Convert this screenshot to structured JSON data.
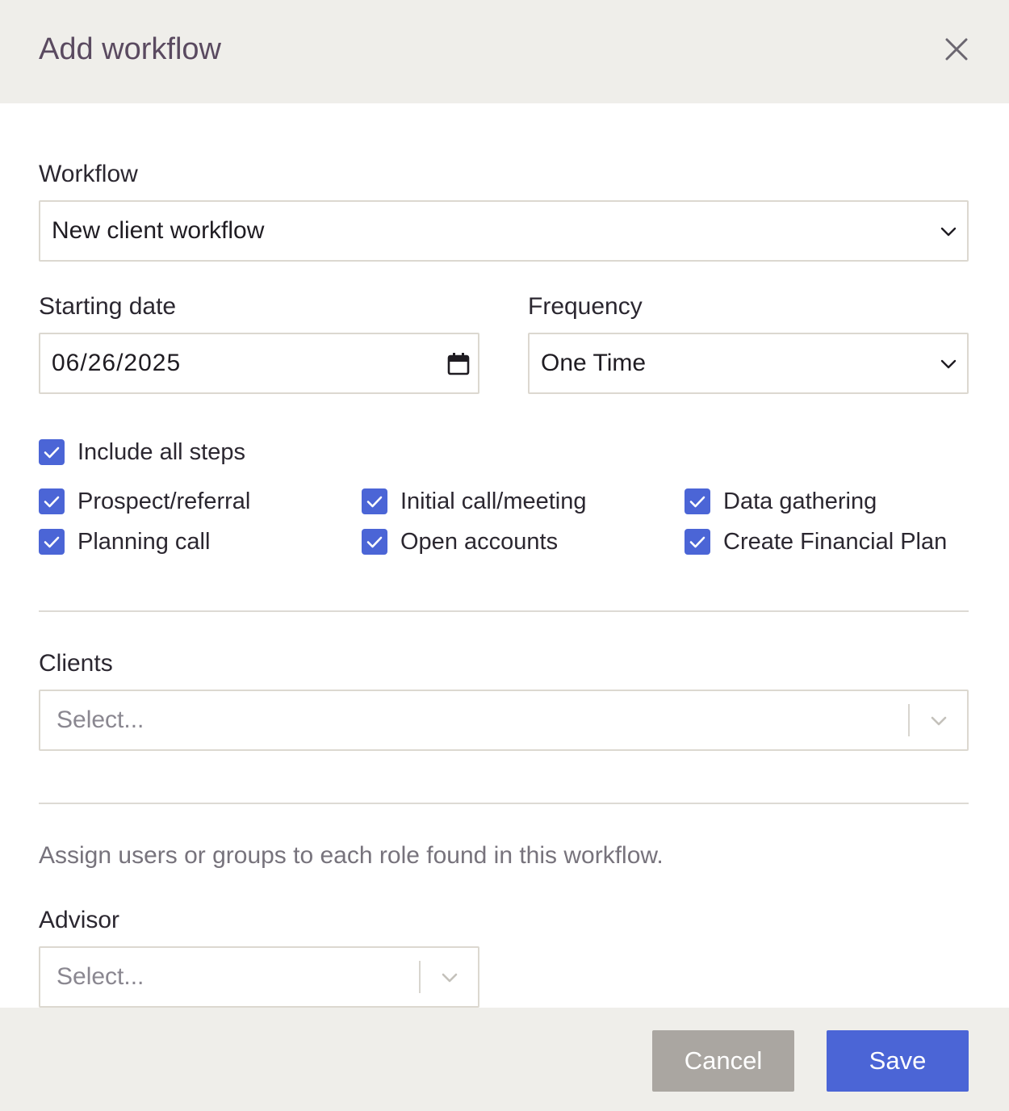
{
  "dialog": {
    "title": "Add workflow"
  },
  "workflow": {
    "label": "Workflow",
    "value": "New client workflow"
  },
  "starting_date": {
    "label": "Starting date",
    "value": "06/26/2025"
  },
  "frequency": {
    "label": "Frequency",
    "value": "One Time"
  },
  "steps": {
    "include_all": {
      "label": "Include all steps",
      "checked": true
    },
    "items": [
      {
        "label": "Prospect/referral",
        "checked": true
      },
      {
        "label": "Initial call/meeting",
        "checked": true
      },
      {
        "label": "Data gathering",
        "checked": true
      },
      {
        "label": "Planning call",
        "checked": true
      },
      {
        "label": "Open accounts",
        "checked": true
      },
      {
        "label": "Create Financial Plan",
        "checked": true
      }
    ]
  },
  "clients": {
    "label": "Clients",
    "placeholder": "Select..."
  },
  "roles": {
    "hint": "Assign users or groups to each role found in this workflow.",
    "advisor": {
      "label": "Advisor",
      "placeholder": "Select..."
    }
  },
  "footer": {
    "cancel_label": "Cancel",
    "save_label": "Save"
  },
  "colors": {
    "accent": "#4b65d6",
    "header_bg": "#efeeea",
    "cancel_bg": "#aaa6a1",
    "title": "#5a4a60"
  },
  "icons": {
    "close": "close-icon",
    "chevron": "chevron-down-icon",
    "calendar": "calendar-icon",
    "check": "check-icon"
  }
}
